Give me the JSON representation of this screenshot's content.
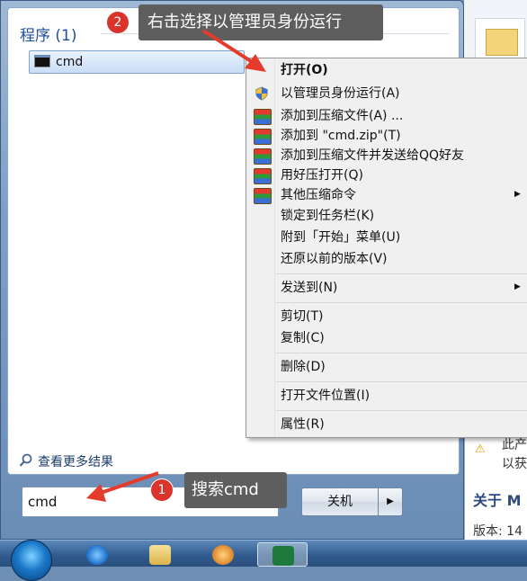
{
  "start_menu": {
    "section_title": "程序 (1)",
    "program_item": "cmd",
    "see_more": "查看更多结果",
    "search_value": "cmd",
    "search_clear": "✕",
    "shutdown_label": "关机",
    "shutdown_arrow": "▶"
  },
  "context_menu": {
    "items": [
      {
        "label": "打开(O)"
      },
      {
        "label": "以管理员身份运行(A)"
      },
      {
        "label": "添加到压缩文件(A) ..."
      },
      {
        "label": "添加到 \"cmd.zip\"(T)"
      },
      {
        "label": "添加到压缩文件并发送给QQ好友"
      },
      {
        "label": "用好压打开(Q)"
      },
      {
        "label": "其他压缩命令"
      },
      {
        "label": "锁定到任务栏(K)"
      },
      {
        "label": "附到「开始」菜单(U)"
      },
      {
        "label": "还原以前的版本(V)"
      },
      {
        "label": "发送到(N)"
      },
      {
        "label": "剪切(T)"
      },
      {
        "label": "复制(C)"
      },
      {
        "label": "删除(D)"
      },
      {
        "label": "打开文件位置(I)"
      },
      {
        "label": "属性(R)"
      }
    ],
    "submenu_arrow": "▶"
  },
  "callouts": {
    "step1_number": "1",
    "step1_text": "搜索cmd",
    "step2_number": "2",
    "step2_text": "右击选择以管理员身份运行"
  },
  "right_panel": {
    "warning_icon": "warning-icon",
    "text_line1": "此产",
    "text_line2": "以获",
    "heading": "关于 M",
    "version": "版本: 14"
  },
  "taskbar": {
    "apps": [
      "start-orb",
      "internet-explorer",
      "windows-explorer",
      "media-player",
      "excel"
    ]
  },
  "colors": {
    "callout_bg": "#5e5e5e",
    "badge_red": "#d9342b",
    "arrow_red": "#e53b2c",
    "section_title_blue": "#1f4fa0"
  }
}
